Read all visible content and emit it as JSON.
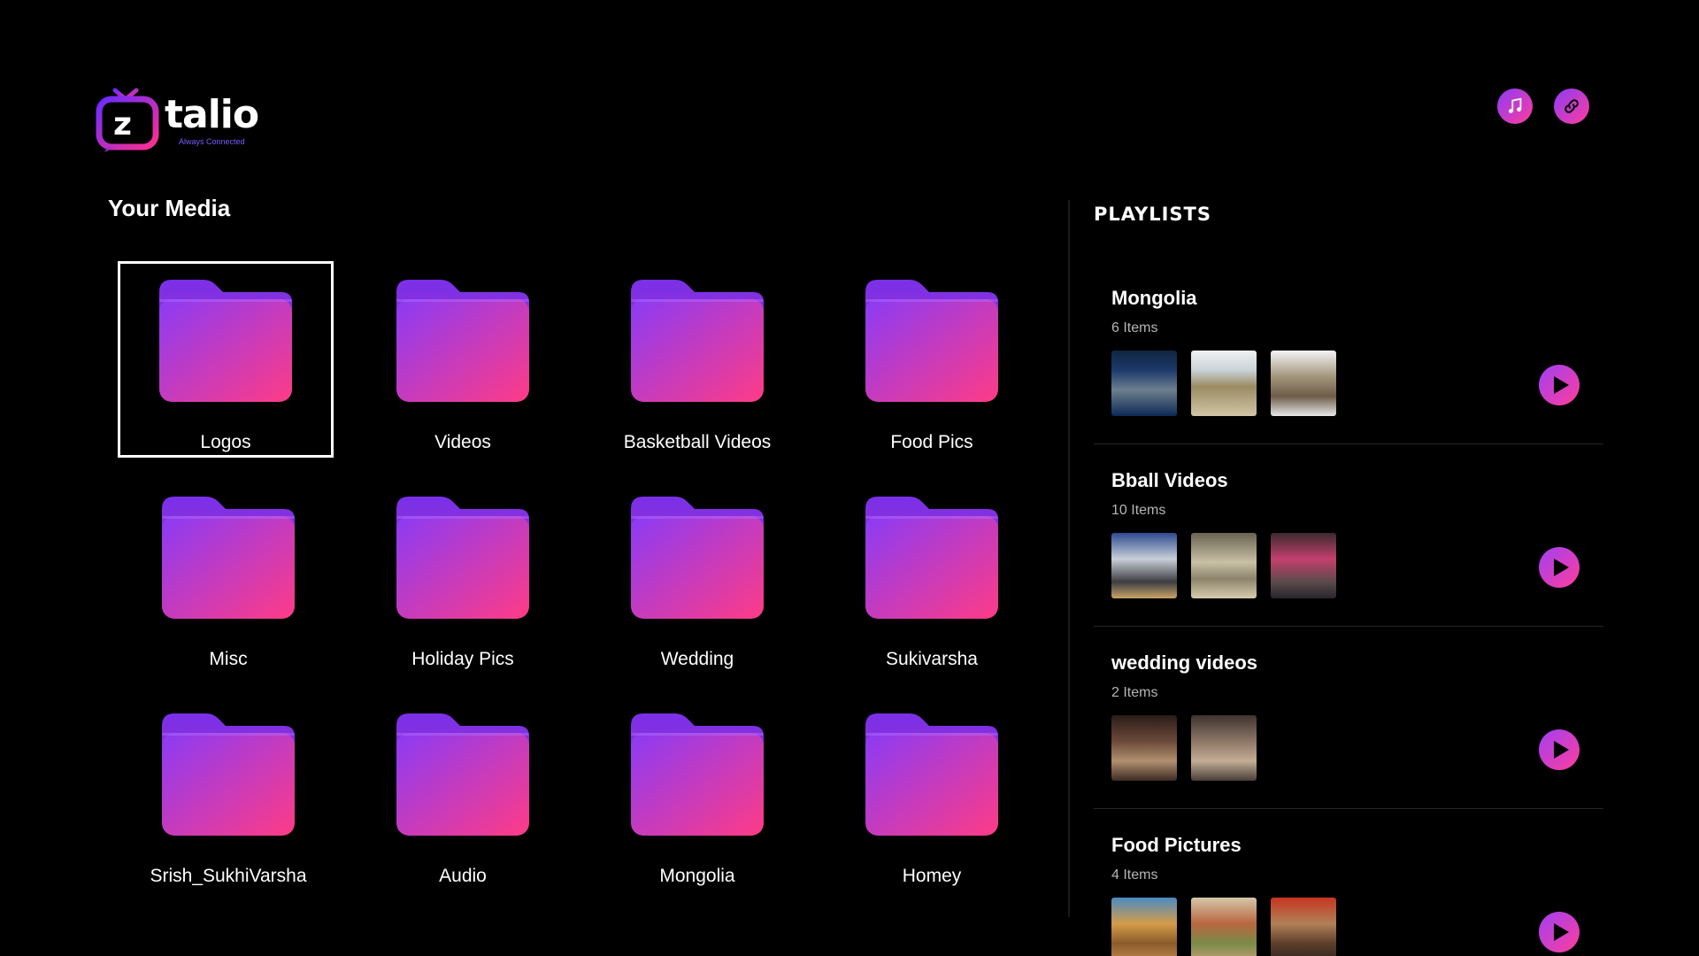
{
  "app": {
    "logo_word": "talio",
    "logo_letter": "z",
    "logo_tagline": "Always Connected"
  },
  "header": {
    "icons": [
      "music-note-icon",
      "link-icon"
    ]
  },
  "colors": {
    "gradient_start": "#8b3cf7",
    "gradient_end": "#ff3c9d",
    "background": "#000000"
  },
  "media": {
    "title": "Your Media",
    "folders": [
      {
        "label": "Logos",
        "selected": true
      },
      {
        "label": "Videos"
      },
      {
        "label": "Basketball Videos"
      },
      {
        "label": "Food Pics"
      },
      {
        "label": "Misc"
      },
      {
        "label": "Holiday Pics"
      },
      {
        "label": "Wedding"
      },
      {
        "label": "Sukivarsha"
      },
      {
        "label": "Srish_SukhiVarsha"
      },
      {
        "label": "Audio"
      },
      {
        "label": "Mongolia"
      },
      {
        "label": "Homey"
      }
    ]
  },
  "playlists": {
    "title": "PLAYLISTS",
    "items": [
      {
        "name": "Mongolia",
        "count": "6 Items",
        "thumbs": 3
      },
      {
        "name": "Bball Videos",
        "count": "10 Items",
        "thumbs": 3
      },
      {
        "name": "wedding videos",
        "count": "2 Items",
        "thumbs": 2
      },
      {
        "name": "Food Pictures",
        "count": "4 Items",
        "thumbs": 3
      }
    ]
  }
}
